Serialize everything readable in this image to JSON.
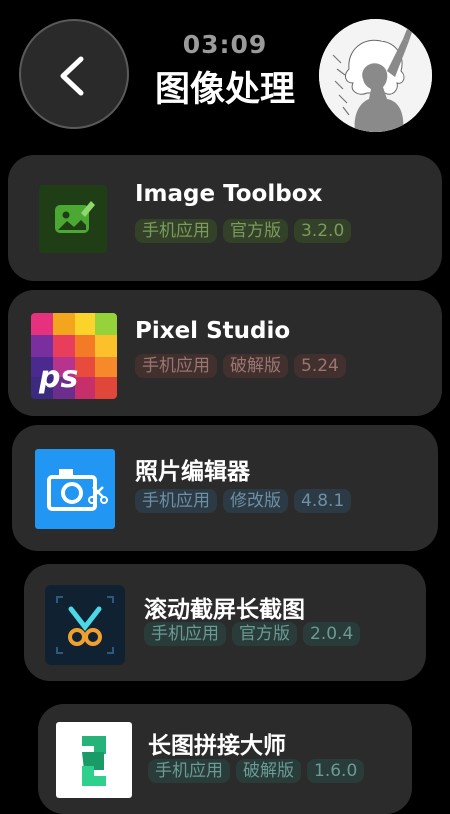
{
  "header": {
    "time": "03:09",
    "title": "图像处理",
    "back_icon": "chevron-left-icon",
    "avatar_icon": "anime-girl-silhouette-avatar"
  },
  "apps": [
    {
      "name": "Image Toolbox",
      "tags": [
        "手机应用",
        "官方版",
        "3.2.0"
      ],
      "tag_color": "#7c9a5d",
      "icon": "image-edit-icon"
    },
    {
      "name": "Pixel Studio",
      "tags": [
        "手机应用",
        "破解版",
        "5.24"
      ],
      "tag_color": "#9a7672",
      "icon": "pixel-studio-ps-icon"
    },
    {
      "name": "照片编辑器",
      "tags": [
        "手机应用",
        "修改版",
        "4.8.1"
      ],
      "tag_color": "#6f8fa3",
      "icon": "camera-scissors-icon"
    },
    {
      "name": "滚动截屏长截图",
      "tags": [
        "手机应用",
        "官方版",
        "2.0.4"
      ],
      "tag_color": "#6a9a95",
      "icon": "scissors-crop-icon"
    },
    {
      "name": "长图拼接大师",
      "tags": [
        "手机应用",
        "破解版",
        "1.6.0"
      ],
      "tag_color": "#6a9a95",
      "icon": "green-s-logo-icon"
    }
  ]
}
